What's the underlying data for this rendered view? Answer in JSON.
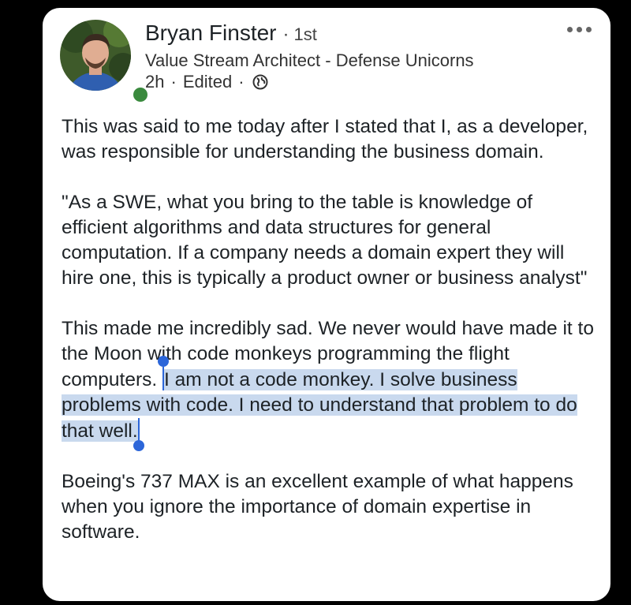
{
  "post": {
    "author": {
      "name": "Bryan Finster",
      "separator": "·",
      "degree": "1st",
      "headline": "Value Stream Architect - Defense Unicorns",
      "time": "2h",
      "edited": "Edited",
      "visibility_icon": "globe-icon",
      "online_status_color": "#3a8a3e"
    },
    "more_icon": "more-options-icon",
    "paragraphs": {
      "p1": "This was said to me today after I stated that I, as a developer, was responsible for understanding the business domain.",
      "p2": "\"As a SWE, what you bring to the table is knowledge of efficient algorithms and data structures for general computation. If a company needs a domain expert they will hire one, this is typically a product owner or business analyst\"",
      "p3_before": "This made me incredibly sad. We never would have made it to the Moon with code monkeys programming the flight computers. ",
      "p3_selected": "I am not a code monkey. I solve business problems with code. I need to understand that problem to do that well.",
      "p4": "Boeing's 737 MAX is an excellent example of what happens when you ignore the importance of domain expertise in software."
    }
  },
  "colors": {
    "selection": "#c9d9ee",
    "selection_handle": "#2c66d9",
    "background": "#000000",
    "card": "#ffffff"
  }
}
